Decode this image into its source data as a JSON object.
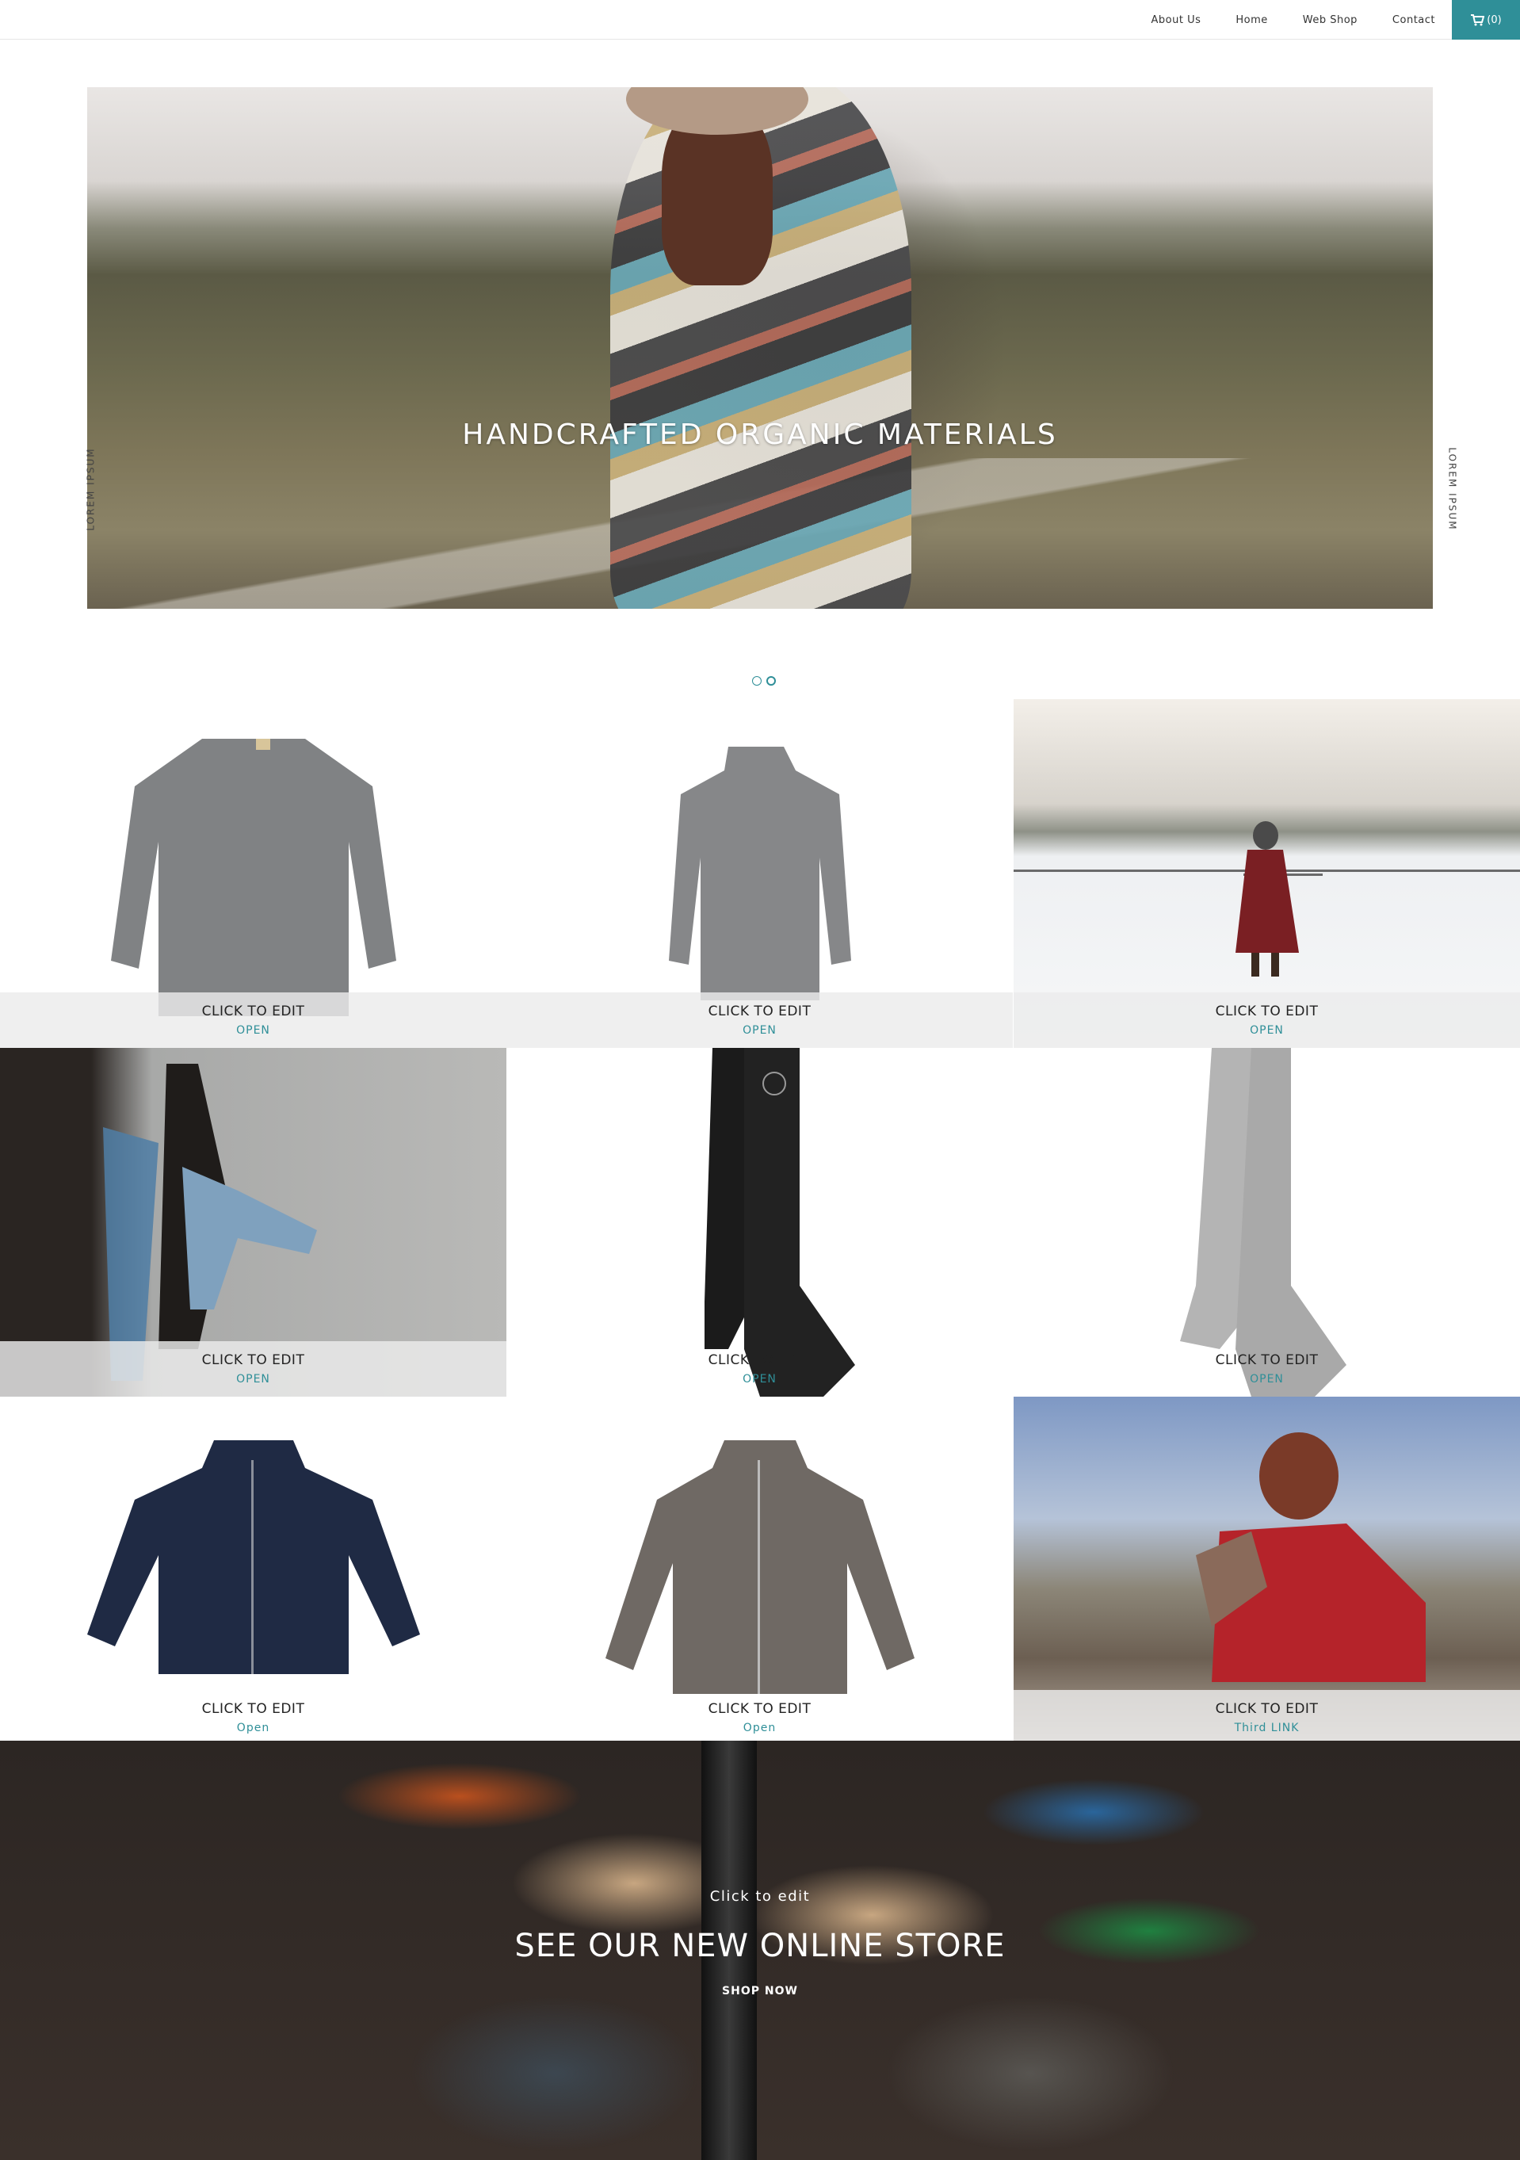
{
  "nav": {
    "items": [
      "About Us",
      "Home",
      "Web Shop",
      "Contact"
    ],
    "cart_label": "(0)"
  },
  "hero": {
    "title": "HANDCRAFTED ORGANIC MATERIALS",
    "side_left": "LOREM IPSUM",
    "side_right": "LOREM IPSUM"
  },
  "tiles": [
    {
      "title": "CLICK TO EDIT",
      "link": "OPEN"
    },
    {
      "title": "CLICK TO EDIT",
      "link": "OPEN"
    },
    {
      "title": "CLICK TO EDIT",
      "link": "OPEN"
    },
    {
      "title": "CLICK TO EDIT",
      "link": "OPEN"
    },
    {
      "title": "CLICK TO EDIT",
      "link": "OPEN"
    },
    {
      "title": "CLICK TO EDIT",
      "link": "OPEN"
    },
    {
      "title": "CLICK TO EDIT",
      "link": "Open"
    },
    {
      "title": "CLICK TO EDIT",
      "link": "Open"
    },
    {
      "title": "CLICK TO EDIT",
      "link": "Third LINK"
    }
  ],
  "banner": {
    "small": "Click to edit",
    "title": "SEE OUR NEW ONLINE STORE",
    "cta": "SHOP NOW"
  },
  "colors": {
    "accent": "#2f8f98"
  }
}
